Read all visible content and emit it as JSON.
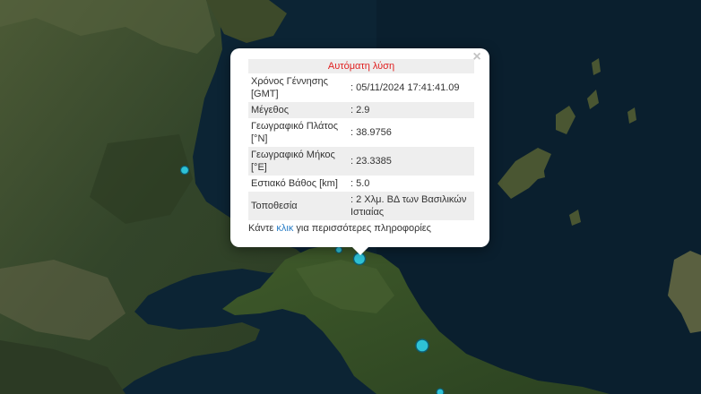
{
  "popup": {
    "title": "Αυτόματη λύση",
    "close_label": "×",
    "rows": [
      {
        "label": "Χρόνος Γέννησης [GMT]",
        "value": ": 05/11/2024 17:41:41.09"
      },
      {
        "label": "Μέγεθος",
        "value": ": 2.9"
      },
      {
        "label": "Γεωγραφικό Πλάτος [°N]",
        "value": ": 38.9756"
      },
      {
        "label": "Γεωγραφικό Μήκος [°E]",
        "value": ": 23.3385"
      },
      {
        "label": "Εστιακό Βάθος [km]",
        "value": ": 5.0"
      },
      {
        "label": "Τοποθεσία",
        "value": ": 2 Χλμ. ΒΔ των Βασιλικών Ιστιαίας"
      }
    ],
    "more_prefix": "Κάντε ",
    "more_link": "κλικ",
    "more_suffix": " για περισσότερες πληροφορίες"
  },
  "colors": {
    "sea": "#0b2233",
    "land": "#3a4a28",
    "marker": "#2ec2d6",
    "title_red": "#e02020",
    "link": "#2a7ec6"
  }
}
